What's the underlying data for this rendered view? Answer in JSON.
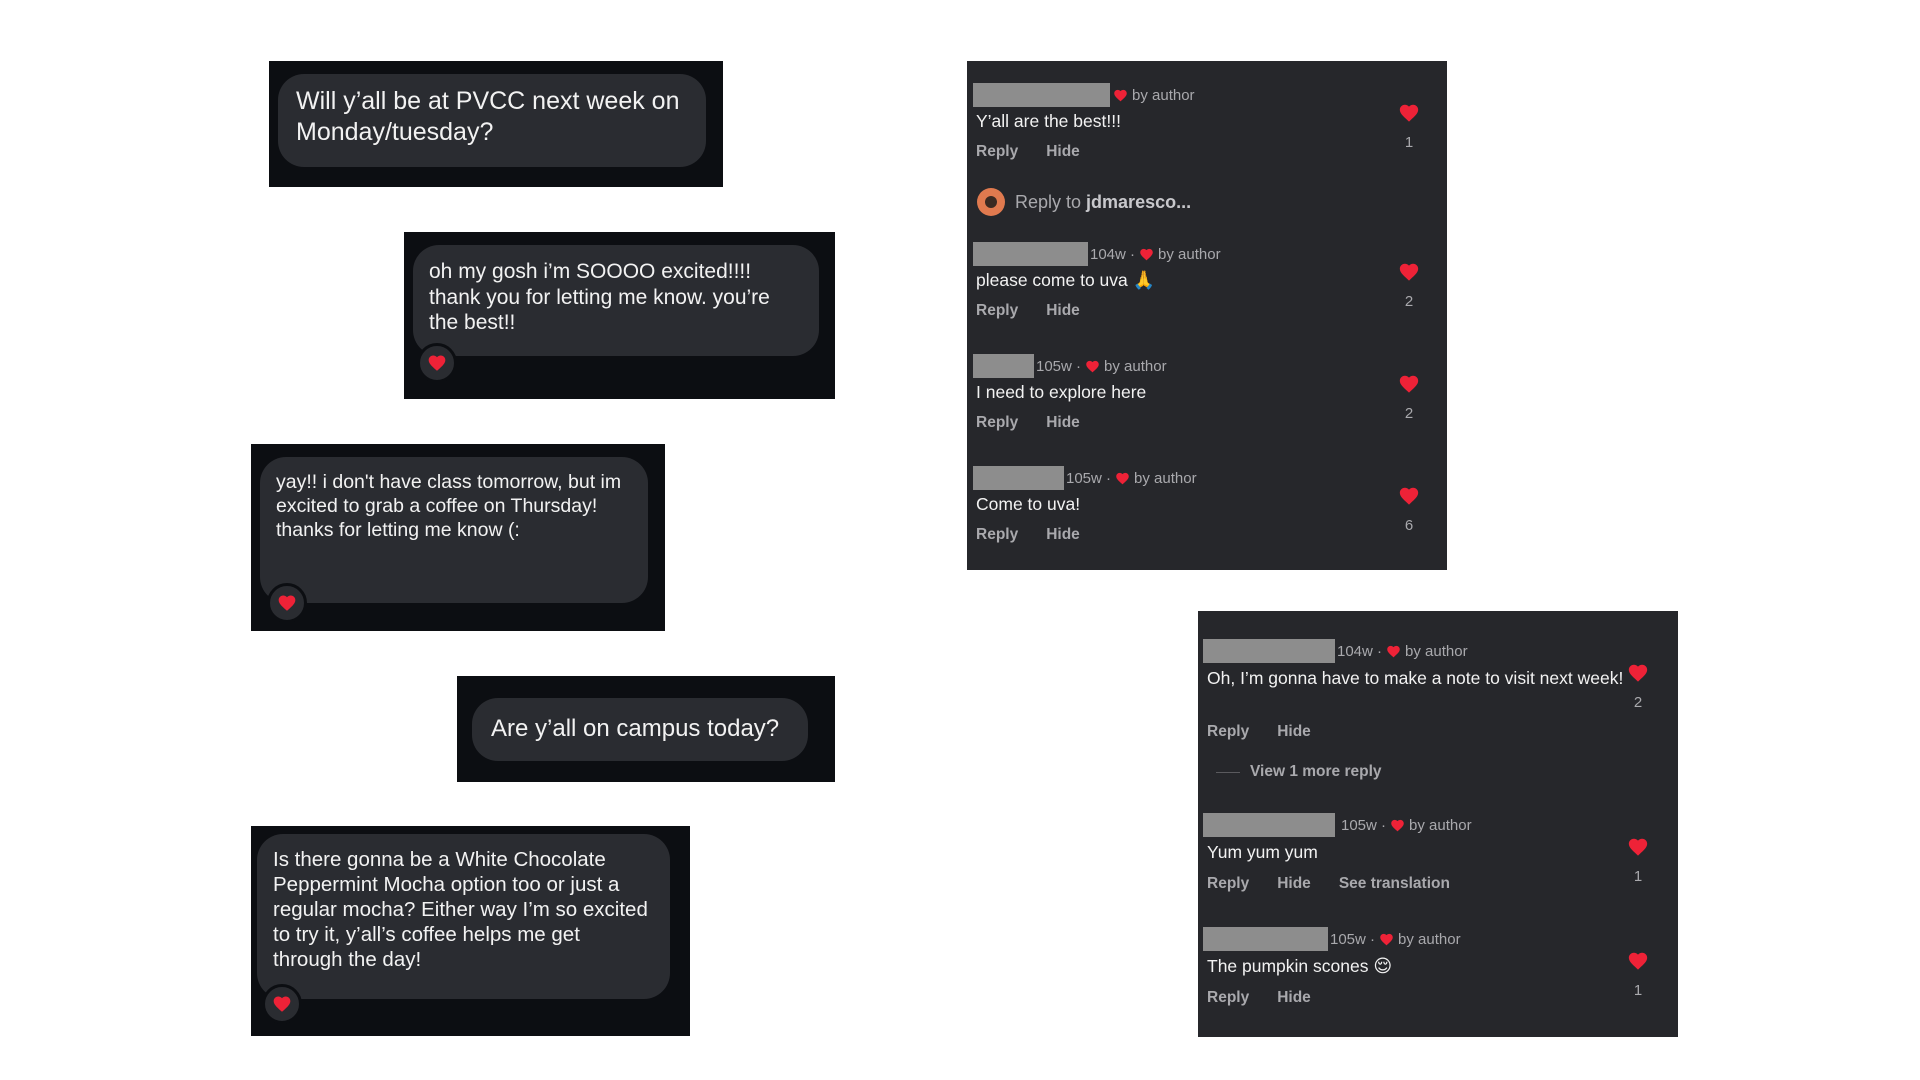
{
  "colors": {
    "dm_bg": "#0c0e12",
    "bubble_bg": "#2a2c31",
    "panel_bg": "#26272b",
    "heart": "#ee2237",
    "muted": "#a9a9ad"
  },
  "dms": [
    {
      "text": "Will y’all be at PVCC next week on Monday/tuesday?",
      "reaction": "heart"
    },
    {
      "text": "oh my gosh i’m SOOOO excited!!!! thank you for letting me know. you’re the best!!",
      "reaction": "heart"
    },
    {
      "text": "yay!! i don't have class tomorrow, but im excited to grab a coffee on Thursday! thanks for letting me know (:",
      "reaction": "heart"
    },
    {
      "text": "Are y’all on campus today?",
      "reaction": ""
    },
    {
      "text": "Is there gonna be a White Chocolate Peppermint Mocha option too or just a regular mocha? Either way I’m so excited to try it, y’all’s coffee helps me get through the day!",
      "reaction": "heart"
    }
  ],
  "panel1": {
    "reply_to_prefix": "Reply to ",
    "reply_to_user": "jdmaresco...",
    "comments": [
      {
        "time": "",
        "liked": "by author",
        "text": "Y’all are the best!!!",
        "emoji": "",
        "reply": "Reply",
        "hide": "Hide",
        "likes": "1"
      },
      {
        "time": "104w ·",
        "liked": "by author",
        "text": "please come to uva",
        "emoji": "🙏",
        "reply": "Reply",
        "hide": "Hide",
        "likes": "2"
      },
      {
        "time": "105w ·",
        "liked": "by author",
        "text": "I need to explore here",
        "emoji": "",
        "reply": "Reply",
        "hide": "Hide",
        "likes": "2"
      },
      {
        "time": "105w ·",
        "liked": "by author",
        "text": "Come to uva!",
        "emoji": "",
        "reply": "Reply",
        "hide": "Hide",
        "likes": "6"
      }
    ]
  },
  "panel2": {
    "view_more": "View 1 more reply",
    "see_translation": "See translation",
    "comments": [
      {
        "time": "104w ·",
        "liked": "by author",
        "text": "Oh, I’m gonna have to make a note to visit next week!",
        "emoji": "",
        "reply": "Reply",
        "hide": "Hide",
        "likes": "2"
      },
      {
        "time": "105w ·",
        "liked": "by author",
        "text": "Yum yum yum",
        "emoji": "",
        "reply": "Reply",
        "hide": "Hide",
        "likes": "1"
      },
      {
        "time": "105w ·",
        "liked": "by author",
        "text": "The pumpkin scones",
        "emoji": "😌",
        "reply": "Reply",
        "hide": "Hide",
        "likes": "1"
      }
    ]
  }
}
